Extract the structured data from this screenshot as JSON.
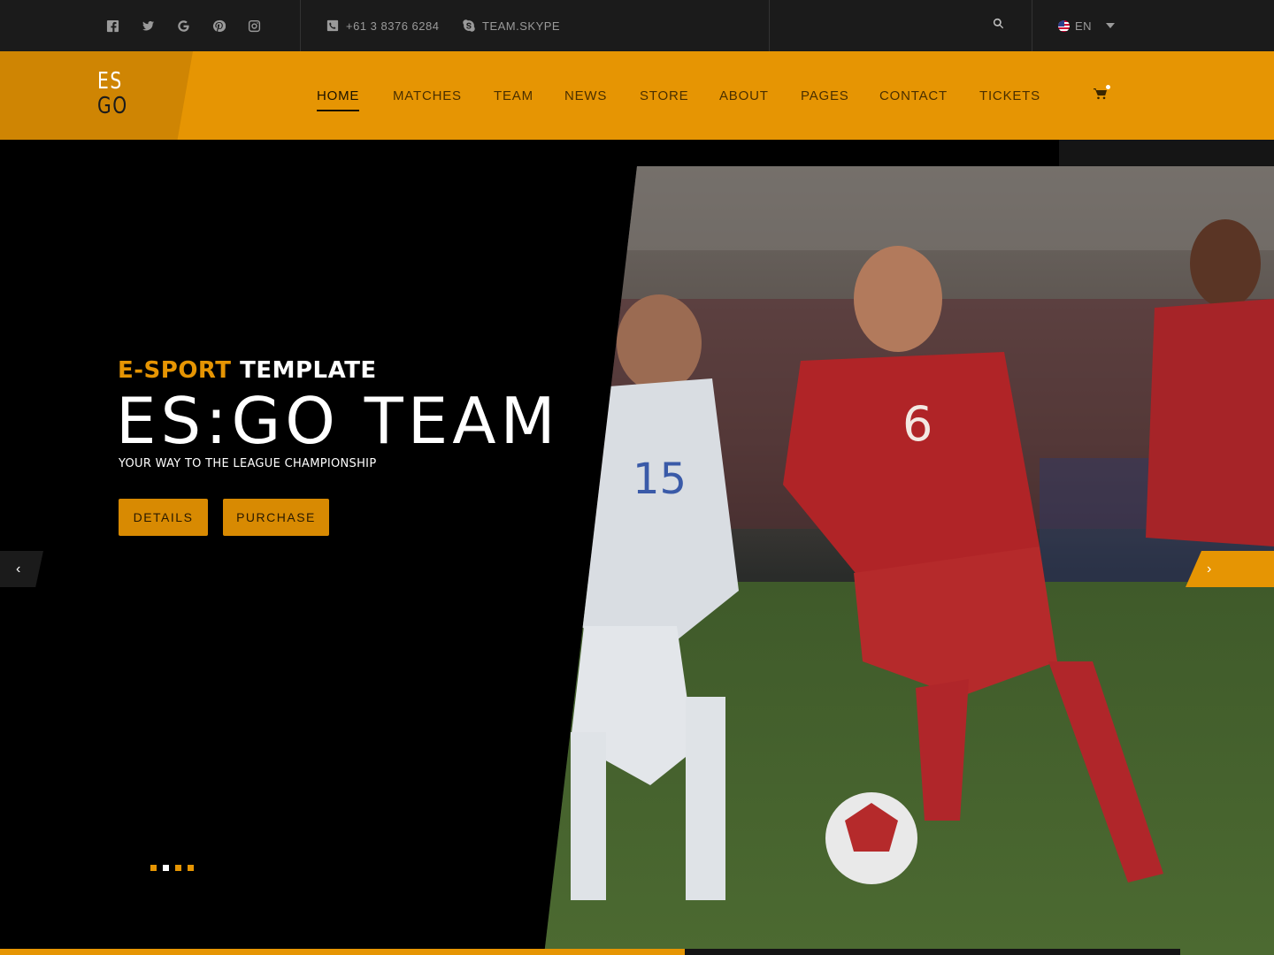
{
  "topbar": {
    "socials": [
      "facebook-icon",
      "twitter-icon",
      "google-icon",
      "pinterest-icon",
      "instagram-icon"
    ],
    "phone": "+61 3 8376 6284",
    "skype": "TEAM.SKYPE",
    "language": "EN"
  },
  "brand": {
    "line1": "ES",
    "line2": "GO"
  },
  "nav": {
    "items": [
      "HOME",
      "MATCHES",
      "TEAM",
      "NEWS",
      "STORE",
      "ABOUT",
      "PAGES",
      "CONTACT",
      "TICKETS"
    ],
    "active": "HOME"
  },
  "hero": {
    "eyebrow_highlight": "E-SPORT",
    "eyebrow_rest": "TEMPLATE",
    "headline": "ES:GO TEAM",
    "tagline": "YOUR WAY TO THE LEAGUE CHAMPIONSHIP",
    "btn_details": "DETAILS",
    "btn_purchase": "PURCHASE",
    "prev_arrow": "‹",
    "next_arrow": "›",
    "slides": 4,
    "active_slide": 2,
    "slide_progress": 0.58
  },
  "colors": {
    "accent": "#e69503",
    "dark": "#1b1b1b"
  }
}
